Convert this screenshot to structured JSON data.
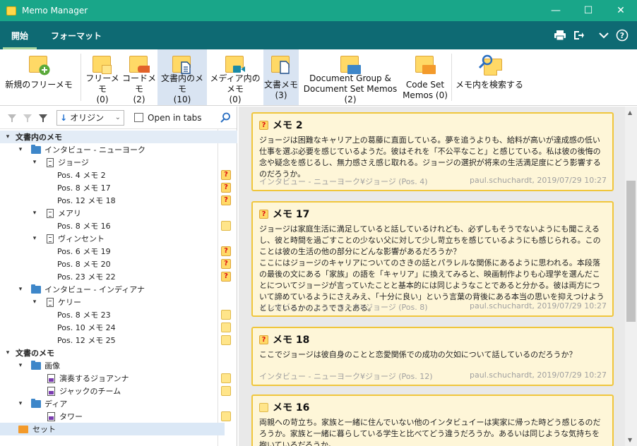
{
  "window": {
    "title": "Memo Manager",
    "minimize": "—",
    "maximize": "☐",
    "close": "✕"
  },
  "tabs": [
    {
      "label": "開始",
      "active": true
    },
    {
      "label": "フォーマット",
      "active": false
    }
  ],
  "tabbar_icons": [
    "printer-icon",
    "export-icon",
    "chevron-down-icon",
    "help-icon"
  ],
  "ribbon": {
    "new_free_memo": "新規のフリーメモ",
    "free_memo": {
      "label": "フリーメモ",
      "count": "(0)"
    },
    "code_memo": {
      "label": "コードメモ",
      "count": "(2)"
    },
    "doc_memo": {
      "label": "文書内のメモ",
      "count": "(10)"
    },
    "media_memo": {
      "label": "メディア内のメモ",
      "count": "(0)"
    },
    "document_memo": {
      "label": "文書メモ",
      "count": "(3)"
    },
    "group_memo": {
      "line1": "Document Group &",
      "line2": "Document Set Memos (2)"
    },
    "codeset_memo": {
      "line1": "Code Set",
      "line2": "Memos (0)"
    },
    "search_memo": "メモ内を検索する"
  },
  "left_toolbar": {
    "sort": "オリジン",
    "open_in_tabs": "Open in tabs"
  },
  "tree": {
    "root1": "文書内のメモ",
    "grp_ny": "インタビュー - ニューヨーク",
    "doc_george": "ジョージ",
    "g1": "Pos. 4   メモ 2",
    "g2": "Pos. 8   メモ 17",
    "g3": "Pos. 12   メモ 18",
    "doc_mary": "メアリ",
    "m1": "Pos. 8   メモ 16",
    "doc_vincent": "ヴィンセント",
    "v1": "Pos. 6   メモ 19",
    "v2": "Pos. 8   メモ 20",
    "v3": "Pos. 23   メモ 22",
    "grp_in": "インタビュー - インディアナ",
    "doc_kelly": "ケリー",
    "k1": "Pos. 8   メモ 23",
    "k2": "Pos. 10   メモ 24",
    "k3": "Pos. 12   メモ 25",
    "root2": "文書のメモ",
    "grp_img": "画像",
    "img1": "演奏するジョアンナ",
    "img2": "ジャックのチーム",
    "grp_dia": "ディア",
    "dia1": "タワー",
    "set": "セット"
  },
  "cards": [
    {
      "title": "メモ 2",
      "body": "ジョージは困難なキャリア上の葛藤に直面している。夢を追うよりも、給料が高いが達成感の低い仕事を選ぶ必要を感じているようだ。彼はそれを「不公平なこと」と感じている。私は彼の後悔の念や疑念を感じるし、無力感さえ感じ取れる。ジョージの選択が将来の生活満足度にどう影響するのだろうか。",
      "source": "インタビュー - ニューヨーク¥ジョージ (Pos. 4)",
      "author": "paul.schuchardt, 2019/07/29 10:27"
    },
    {
      "title": "メモ 17",
      "body": "ジョージは家庭生活に満足していると話しているけれども、必ずしもそうでないようにも聞こえるし、彼と時間を過ごすことの少ない父に対して少し苛立ちを感じているようにも感じられる。このことは彼の生活の他の部分にどんな影響があるだろうか？\nここにはジョージのキャリアについてのさきの話とパラレルな関係にあるように思われる。本段落の最後の文にある「家族」の語を「キャリア」に換えてみると、映画制作よりも心理学を選んだことについてジョージが言っていたことと基本的には同じようなことであると分かる。彼は両方について諦めているようにさえみえ、「十分に良い」という言葉の背後にある本当の思いを抑えつけようとしているかのようでさえある。",
      "source": "インタビュー - ニューヨーク¥ジョージ (Pos. 8)",
      "author": "paul.schuchardt, 2019/07/29 10:27"
    },
    {
      "title": "メモ 18",
      "body": "ここでジョージは彼自身のことと恋愛関係での成功の欠如について話しているのだろうか？",
      "source": "インタビュー - ニューヨーク¥ジョージ (Pos. 12)",
      "author": "paul.schuchardt, 2019/07/29 10:27"
    },
    {
      "title": "メモ 16",
      "body": "両親への苛立ち。家族と一緒に住んでいない他のインタビュイーは実家に帰った時どう感じるのだろうか。家族と一緒に暮らしている学生と比べてどう違うだろうか。あるいは同じような気持ちを抱いているだろうか。",
      "source": "",
      "author": ""
    }
  ]
}
